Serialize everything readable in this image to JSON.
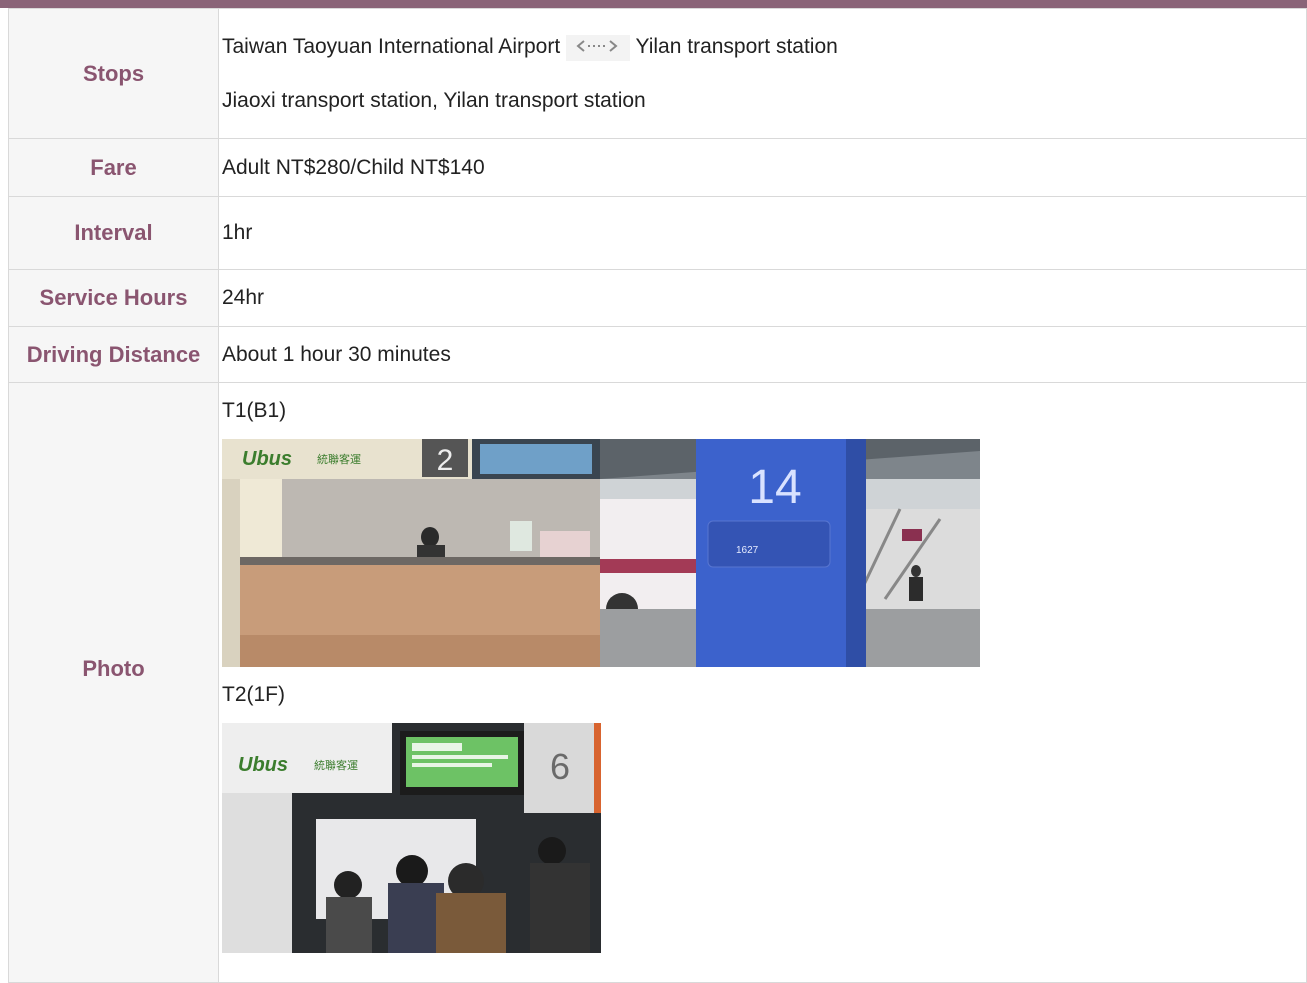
{
  "colors": {
    "header_bar": "#8a6478",
    "label_text": "#8a5570",
    "label_background": "#f6f6f6",
    "border": "#d9d9d9"
  },
  "rows": {
    "stops": {
      "label": "Stops",
      "line1_from": "Taiwan Taoyuan International Airport",
      "line1_icon": "double-arrow-icon",
      "line1_to": "Yilan transport station",
      "line2": "Jiaoxi transport station, Yilan transport station"
    },
    "fare": {
      "label": "Fare",
      "value": "Adult NT$280/Child NT$140"
    },
    "interval": {
      "label": "Interval",
      "value": "1hr"
    },
    "service_hours": {
      "label": "Service Hours",
      "value": "24hr"
    },
    "driving_distance": {
      "label": "Driving Distance",
      "value": "About 1 hour 30 minutes"
    },
    "photo": {
      "label": "Photo",
      "t1_label": "T1(B1)",
      "t2_label": "T2(1F)",
      "t1_photos": {
        "counter": {
          "brand_text": "Ubus",
          "brand_cn": "統聯客運",
          "counter_number": "2"
        },
        "sign": {
          "platform_number": "14",
          "sign_number": "1627"
        }
      },
      "t2_photos": {
        "counter": {
          "brand_text": "Ubus",
          "brand_cn": "統聯客運",
          "counter_number": "6"
        }
      }
    }
  }
}
